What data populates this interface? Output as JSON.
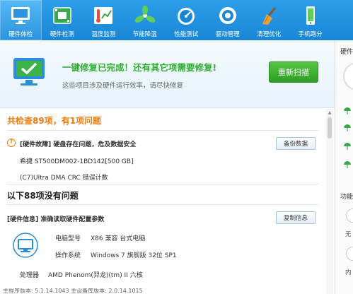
{
  "toolbar": {
    "items": [
      {
        "label": "硬件体检",
        "icon": "monitor-icon"
      },
      {
        "label": "硬件检测",
        "icon": "board-icon"
      },
      {
        "label": "温度监测",
        "icon": "thermometer-icon"
      },
      {
        "label": "节能降温",
        "icon": "fan-icon"
      },
      {
        "label": "性能测试",
        "icon": "speedometer-icon"
      },
      {
        "label": "驱动管理",
        "icon": "gear-icon"
      },
      {
        "label": "清理优化",
        "icon": "broom-icon"
      },
      {
        "label": "手机跑分",
        "icon": "phone-icon"
      }
    ]
  },
  "status": {
    "headline": "一键修复已完成！还有其它项需要修复!",
    "subline": "这些项目涉及硬件运行效率，请尽快修复",
    "rescan_label": "重新扫描"
  },
  "summary": "共检查89项，有1项问题",
  "fault": {
    "title": "[硬件故障] 硬盘存在问题，危及数据安全",
    "button": "备份数据",
    "disk": "希捷 ST500DM002-1BD142[500 GB]",
    "detail": "(C7)Ultra DMA CRC 错误计数"
  },
  "ok_title": "以下88项没有问题",
  "hwinfo": {
    "title": "[硬件信息] 准确读取硬件配置参数",
    "button": "复制信息",
    "rows": [
      {
        "k": "电脑型号",
        "v": "X86 兼容 台式电脑"
      },
      {
        "k": "操作系统",
        "v": "Windows 7 旗舰版 32位 SP1"
      }
    ],
    "cpu_key": "处理器",
    "cpu_val": "AMD Phenom(羿龙)(tm) II 六核"
  },
  "right": {
    "title1": "硬件",
    "title2": "功能",
    "item1": "无",
    "item2": "内"
  },
  "footer": "主程序版本: 5.1.14.1043   主设备库版本: 2.0.14.1015",
  "colors": {
    "accent_blue": "#1a86d6",
    "ok_green": "#2fae2f",
    "warn_orange": "#ef7d10"
  }
}
